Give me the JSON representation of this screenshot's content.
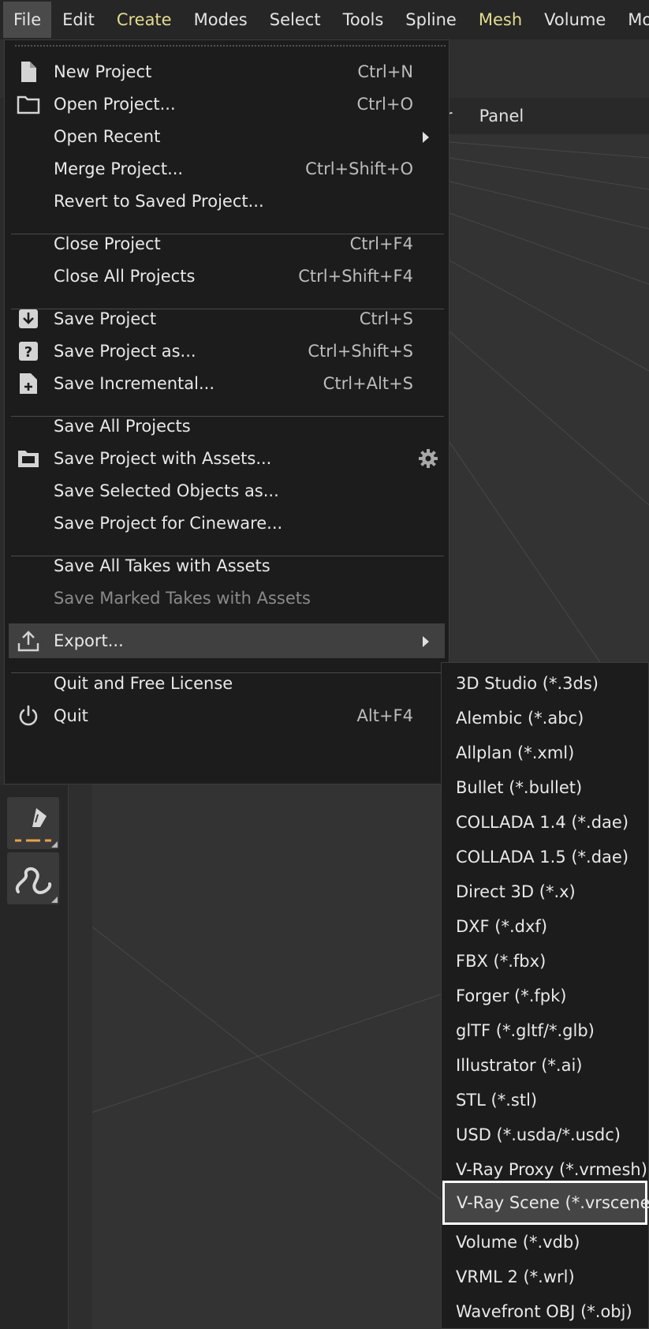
{
  "menubar": {
    "items": [
      "File",
      "Edit",
      "Create",
      "Modes",
      "Select",
      "Tools",
      "Spline",
      "Mesh",
      "Volume",
      "MoGr"
    ]
  },
  "background": {
    "toolbar_items": [
      "er",
      "Panel"
    ]
  },
  "file_menu": {
    "groups": [
      [
        {
          "label": "New Project",
          "shortcut": "Ctrl+N",
          "icon": "document-icon"
        },
        {
          "label": "Open Project...",
          "shortcut": "Ctrl+O",
          "icon": "folder-icon"
        },
        {
          "label": "Open Recent",
          "shortcut": "",
          "submenu": true
        },
        {
          "label": "Merge Project...",
          "shortcut": "Ctrl+Shift+O"
        },
        {
          "label": "Revert to Saved Project...",
          "shortcut": ""
        }
      ],
      [
        {
          "label": "Close Project",
          "shortcut": "Ctrl+F4"
        },
        {
          "label": "Close All Projects",
          "shortcut": "Ctrl+Shift+F4"
        }
      ],
      [
        {
          "label": "Save Project",
          "shortcut": "Ctrl+S",
          "icon": "save-download-icon"
        },
        {
          "label": "Save Project as...",
          "shortcut": "Ctrl+Shift+S",
          "icon": "save-as-question-icon"
        },
        {
          "label": "Save Incremental...",
          "shortcut": "Ctrl+Alt+S",
          "icon": "save-incremental-plus-icon"
        }
      ],
      [
        {
          "label": "Save All Projects",
          "shortcut": ""
        },
        {
          "label": "Save Project with Assets...",
          "shortcut": "",
          "icon": "folder-filled-icon",
          "gear": true
        },
        {
          "label": "Save Selected Objects as...",
          "shortcut": ""
        },
        {
          "label": "Save Project for Cineware...",
          "shortcut": ""
        }
      ],
      [
        {
          "label": "Save All Takes with Assets",
          "shortcut": ""
        },
        {
          "label": "Save Marked Takes with Assets",
          "shortcut": "",
          "disabled": true
        }
      ],
      [
        {
          "label": "Export...",
          "shortcut": "",
          "icon": "upload-export-icon",
          "submenu": true,
          "active": true
        }
      ],
      [
        {
          "label": "Quit and Free License",
          "shortcut": ""
        },
        {
          "label": "Quit",
          "shortcut": "Alt+F4",
          "icon": "power-icon"
        }
      ]
    ]
  },
  "export_submenu": {
    "items": [
      "3D Studio (*.3ds)",
      "Alembic (*.abc)",
      "Allplan (*.xml)",
      "Bullet (*.bullet)",
      "COLLADA 1.4 (*.dae)",
      "COLLADA 1.5 (*.dae)",
      "Direct 3D (*.x)",
      "DXF (*.dxf)",
      "FBX (*.fbx)",
      "Forger (*.fpk)",
      "glTF (*.gltf/*.glb)",
      "Illustrator (*.ai)",
      "STL (*.stl)",
      "USD (*.usda/*.usdc)",
      "V-Ray Proxy (*.vrmesh)",
      "V-Ray Scene (*.vrscene)",
      "Volume (*.vdb)",
      "VRML 2 (*.wrl)",
      "Wavefront OBJ (*.obj)"
    ],
    "selected": "V-Ray Scene (*.vrscene)"
  },
  "colors": {
    "highlight_menu": "#e3dc8f",
    "menu_bg": "#1c1c1c",
    "selection_border": "#ffffff",
    "accent_orange": "#e8a24a"
  }
}
